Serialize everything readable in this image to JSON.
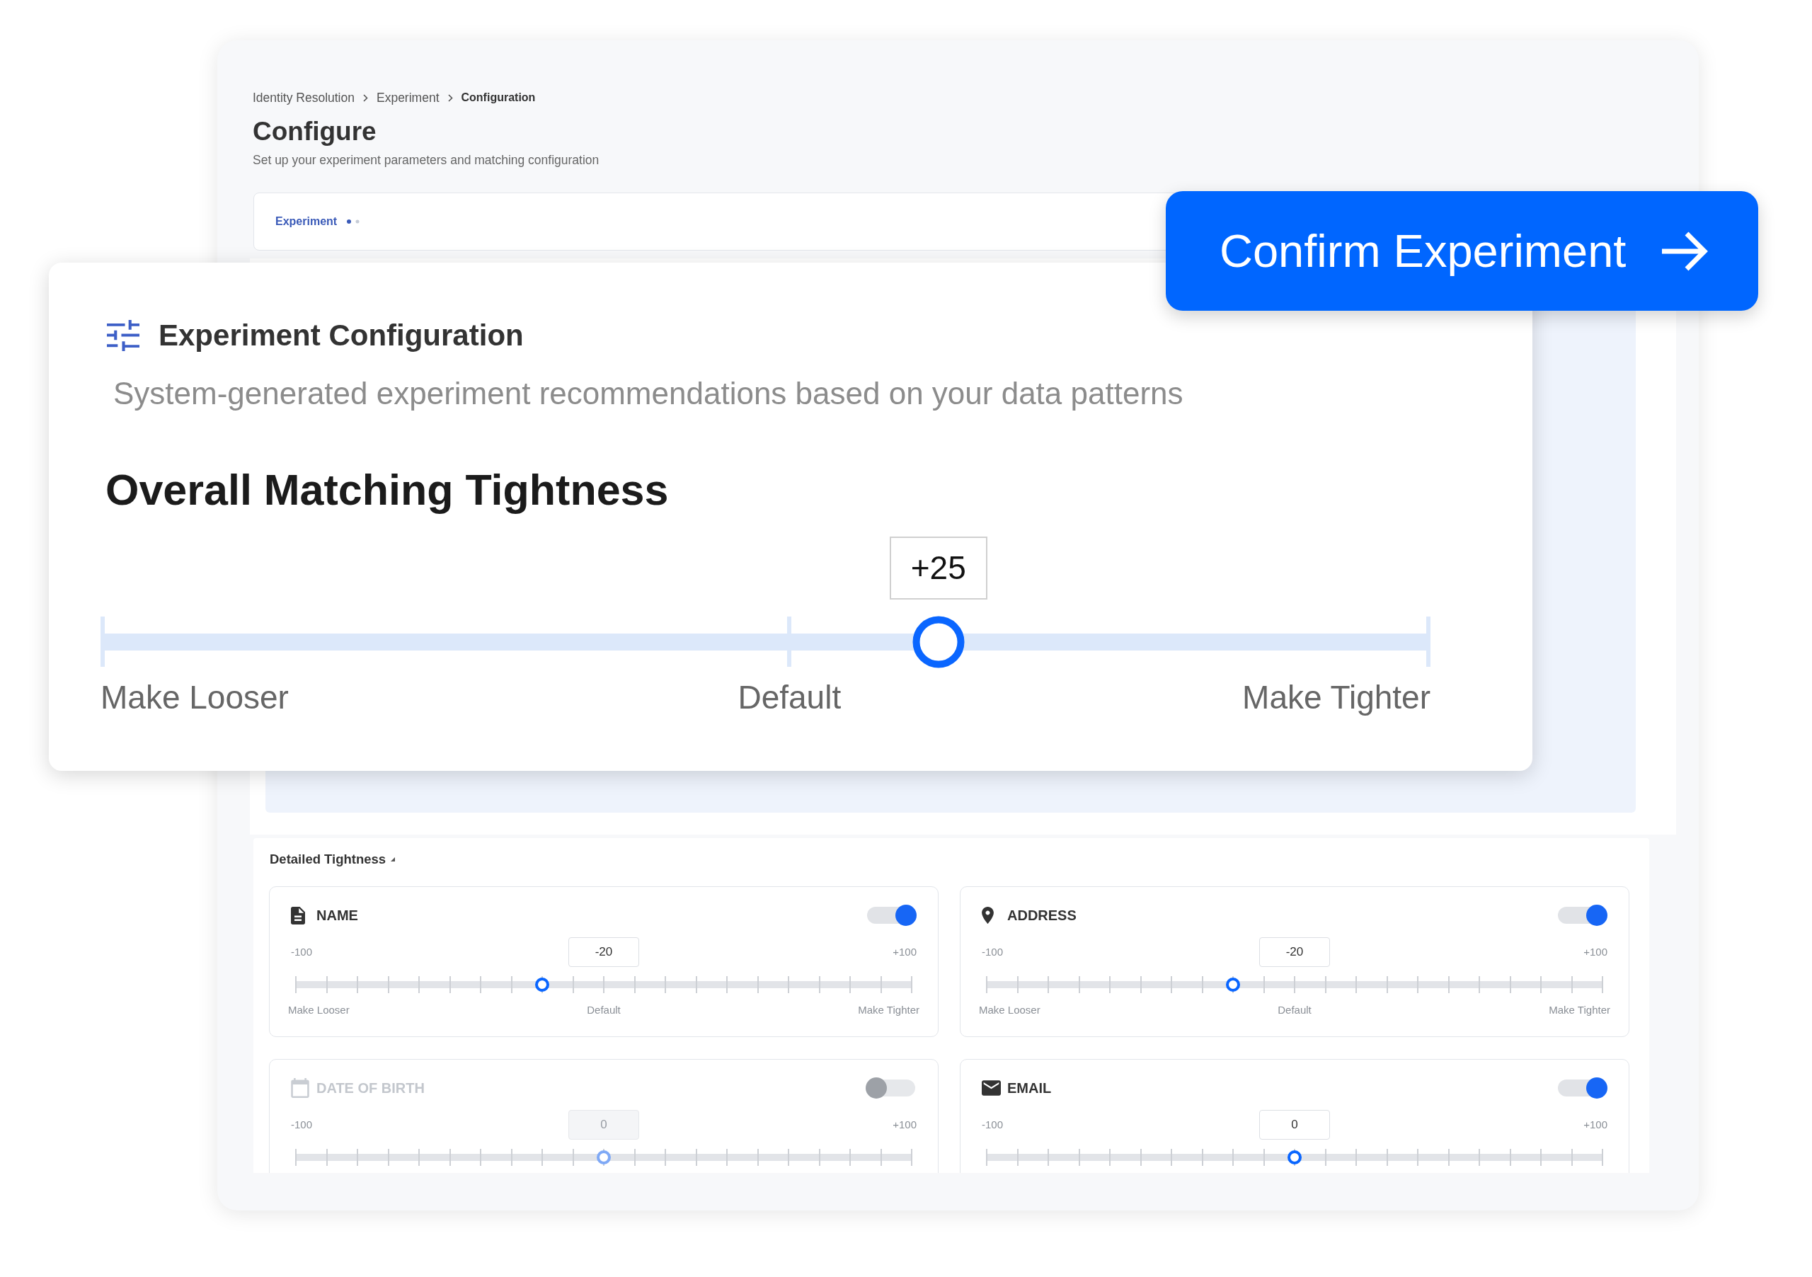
{
  "app_window": {
    "breadcrumb": [
      {
        "label": "Identity Resolution",
        "current": false
      },
      {
        "label": "Experiment",
        "current": false
      },
      {
        "label": "Configuration",
        "current": true
      }
    ],
    "title": "Configure",
    "subtitle": "Set up your experiment parameters and matching configuration",
    "tabs": [
      {
        "label": "Experiment",
        "selected": true
      }
    ],
    "detailed_tightness": {
      "title": "Detailed Tightness",
      "fields": [
        {
          "kind": "name",
          "label": "NAME",
          "on": true,
          "min": "-100",
          "max": "+100",
          "value": "-20",
          "level": 0.4,
          "labels": [
            "Make Looser",
            "Default",
            "Make Tighter"
          ]
        },
        {
          "kind": "address",
          "label": "ADDRESS",
          "on": true,
          "min": "-100",
          "max": "+100",
          "value": "-20",
          "level": 0.4,
          "labels": [
            "Make Looser",
            "Default",
            "Make Tighter"
          ]
        },
        {
          "kind": "date",
          "label": "DATE OF BIRTH",
          "on": false,
          "min": "-100",
          "max": "+100",
          "value": "0",
          "level": 0.5
        },
        {
          "kind": "email",
          "label": "EMAIL",
          "on": true,
          "min": "-100",
          "max": "+100",
          "value": "0",
          "level": 0.5
        }
      ]
    }
  },
  "config_card": {
    "title": "Experiment Configuration",
    "subtitle": "System-generated experiment recommendations based on your data patterns",
    "tightness": {
      "title": "Overall Matching Tightness",
      "value": "+25",
      "level": 0.63,
      "labels": [
        "Make Looser",
        "Default",
        "Make Tighter"
      ]
    }
  },
  "confirm_button": {
    "label": "Confirm Experiment"
  }
}
